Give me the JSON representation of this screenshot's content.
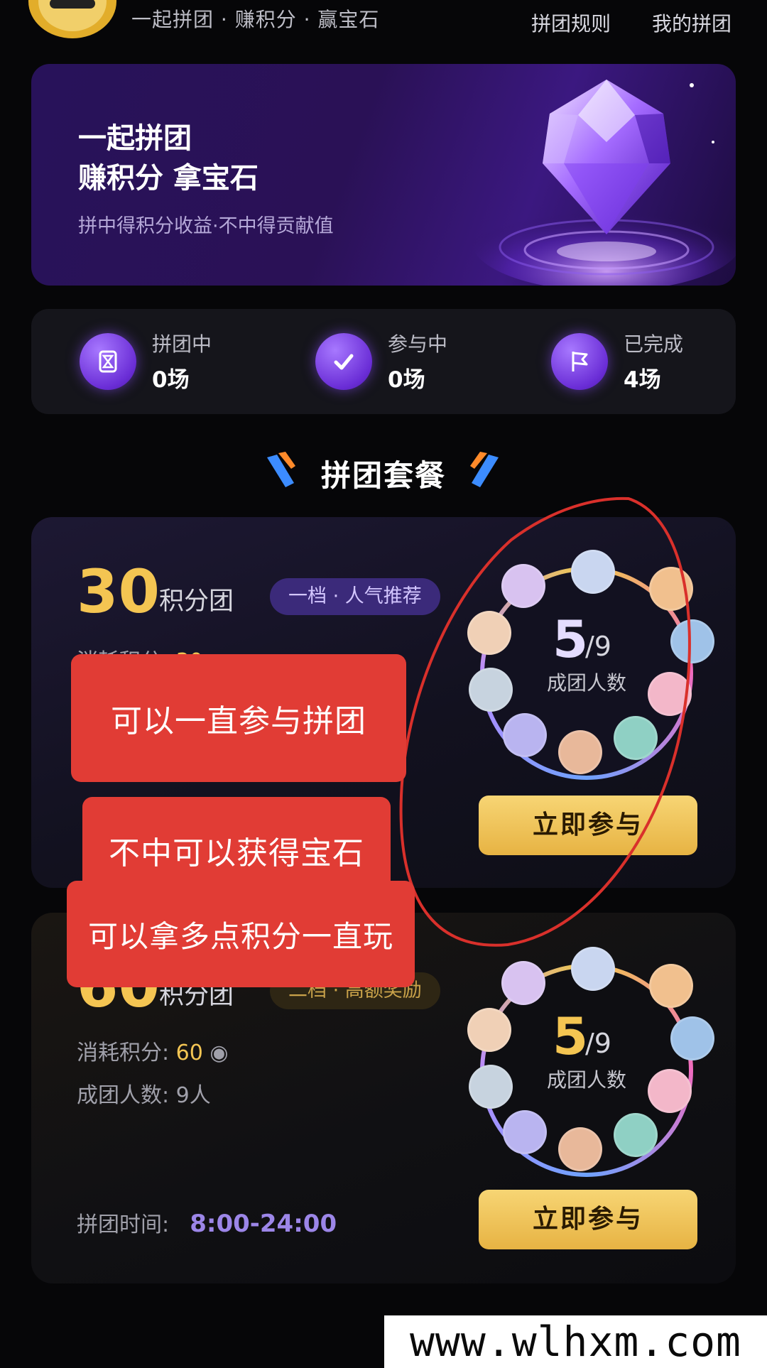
{
  "header": {
    "slogan": "一起拼团 · 赚积分 · 赢宝石",
    "rules_link": "拼团规则",
    "my_groups_link": "我的拼团"
  },
  "banner": {
    "title_line1": "一起拼团",
    "title_line2": "赚积分 拿宝石",
    "subtitle": "拼中得积分收益·不中得贡献值"
  },
  "stats": [
    {
      "label": "拼团中",
      "value": "0场",
      "icon": "hourglass-icon"
    },
    {
      "label": "参与中",
      "value": "0场",
      "icon": "checkmark-icon"
    },
    {
      "label": "已完成",
      "value": "4场",
      "icon": "flag-icon"
    }
  ],
  "section": {
    "title": "拼团套餐"
  },
  "packages": [
    {
      "points": "30",
      "unit": "积分团",
      "tag": "一档 · 人气推荐",
      "cost_label": "消耗积分: ",
      "cost_value": "30",
      "members_current": "5",
      "members_total": "/9",
      "members_label": "成团人数",
      "join_label": "立即参与"
    },
    {
      "points": "60",
      "unit": "积分团",
      "tag": "二档 · 高额奖励",
      "cost_label": "消耗积分: ",
      "cost_value": "60",
      "group_size": "成团人数: 9人",
      "time_label": "拼团时间:",
      "time_value": "8:00-24:00",
      "members_current": "5",
      "members_total": "/9",
      "members_label": "成团人数",
      "join_label": "立即参与"
    }
  ],
  "overlay_notes": [
    "可以一直参与拼团",
    "不中可以获得宝石",
    "可以拿多点积分一直玩"
  ],
  "watermark": "www.wlhxm.com",
  "colors": {
    "accent_gold": "#f4c552",
    "accent_purple": "#7a3ff0",
    "note_red": "#e13c35",
    "annotation_circle": "#d9302b"
  }
}
